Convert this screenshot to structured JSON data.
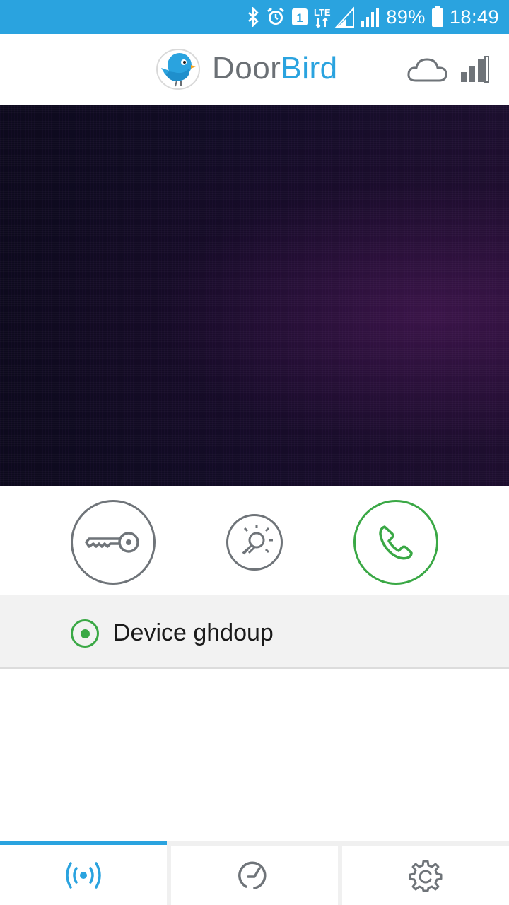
{
  "status_bar": {
    "battery_percent": "89%",
    "time": "18:49",
    "network_type": "LTE",
    "sim_slot": "1",
    "icons": [
      "bluetooth-icon",
      "alarm-icon",
      "sim-icon",
      "lte-signal-icon",
      "signal-icon",
      "battery-icon"
    ]
  },
  "header": {
    "logo_part1": "Door",
    "logo_part2": "Bird",
    "icons": [
      "cloud-icon",
      "signal-strength-icon"
    ]
  },
  "video": {
    "description_icon": "live-video-feed"
  },
  "actions": {
    "buttons": [
      "open-door-key",
      "light",
      "call"
    ]
  },
  "device": {
    "name": "Device ghdoup",
    "selected": true
  },
  "bottom_nav": {
    "tabs": [
      "live-broadcast-icon",
      "history-icon",
      "settings-gear-icon"
    ],
    "active_index": 0
  },
  "colors": {
    "accent": "#2aa3df",
    "call_green": "#3aa845",
    "icon_gray": "#6f7479"
  }
}
